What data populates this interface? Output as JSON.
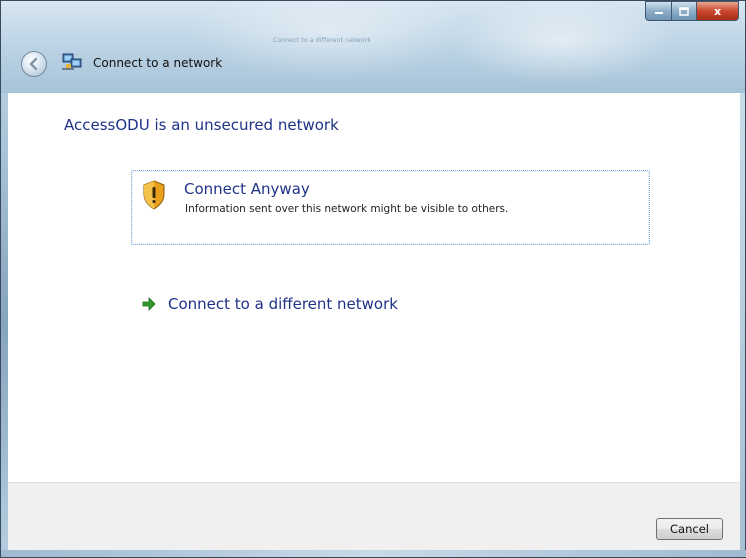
{
  "window": {
    "title": "Connect to a network",
    "ghost_title": "Connect to a different network",
    "controls": {
      "minimize_icon": "minimize-icon",
      "maximize_icon": "maximize-icon",
      "close_icon": "close-icon",
      "close_glyph": "x"
    },
    "back_icon": "back-arrow-icon",
    "app_icon": "network-icon"
  },
  "main": {
    "heading": "AccessODU is an unsecured network",
    "connect_anyway": {
      "title": "Connect Anyway",
      "description": "Information sent over this network might be visible to others.",
      "icon": "shield-warning-icon"
    },
    "different_network": {
      "label": "Connect to a different network",
      "icon": "green-arrow-icon"
    }
  },
  "footer": {
    "cancel_label": "Cancel"
  },
  "colors": {
    "link_blue": "#1e3287",
    "close_red": "#c9492f",
    "arrow_green": "#2f9a2a"
  }
}
